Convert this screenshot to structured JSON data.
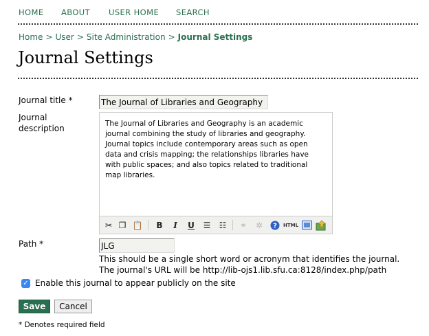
{
  "nav": {
    "home": "HOME",
    "about": "ABOUT",
    "user_home": "USER HOME",
    "search": "SEARCH"
  },
  "breadcrumb": {
    "items": [
      "Home",
      "User",
      "Site Administration"
    ],
    "separator": ">",
    "current": "Journal Settings"
  },
  "page_title": "Journal Settings",
  "form": {
    "journal_title_label": "Journal title *",
    "journal_title_value": "The Journal of Libraries and Geography",
    "description_label_1": "Journal",
    "description_label_2": "description",
    "description_value": "The Journal of Libraries and Geography is an academic journal combining the study of libraries and geography. Journal topics include contemporary areas such as open data and crisis mapping; the relationships libraries have with public spaces; and also topics related to traditional map libraries.",
    "path_label": "Path *",
    "path_value": "JLG",
    "path_hint": "This should be a single short word or acronym that identifies the journal. The journal's URL will be http://lib-ojs1.lib.sfu.ca:8128/index.php/path",
    "enable_label": "Enable this journal to appear publicly on the site",
    "enable_checked": true
  },
  "toolbar": {
    "html_label": "HTML",
    "bold": "B",
    "italic": "I",
    "underline": "U"
  },
  "buttons": {
    "save": "Save",
    "cancel": "Cancel"
  },
  "footnote": "* Denotes required field",
  "colors": {
    "accent": "#2a6f50",
    "checkbox": "#3a87f0"
  }
}
